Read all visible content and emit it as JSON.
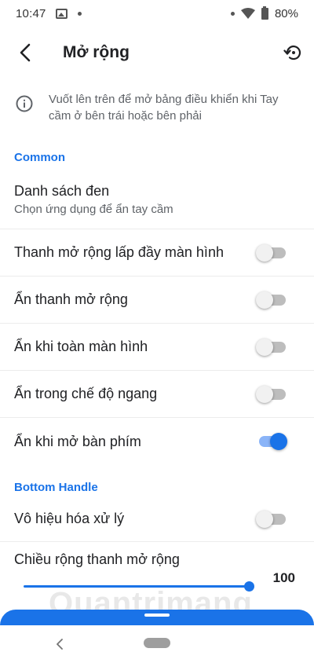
{
  "status_bar": {
    "time": "10:47",
    "battery": "80%"
  },
  "app_bar": {
    "title": "Mở rộng"
  },
  "info": {
    "text": "Vuốt lên trên để mở bảng điều khiển khi Tay cầm ở bên trái hoặc bên phải"
  },
  "sections": {
    "common": {
      "header": "Common",
      "blacklist": {
        "label": "Danh sách đen",
        "sublabel": "Chọn ứng dụng để ẩn tay cầm"
      },
      "fill_screen": {
        "label": "Thanh mở rộng lấp đầy màn hình",
        "on": false
      },
      "hide_handle": {
        "label": "Ẩn thanh mở rộng",
        "on": false
      },
      "hide_fullscreen": {
        "label": "Ẩn khi toàn màn hình",
        "on": false
      },
      "hide_landscape": {
        "label": "Ẩn trong chế độ ngang",
        "on": false
      },
      "hide_keyboard": {
        "label": "Ẩn khi mở bàn phím",
        "on": true
      }
    },
    "bottom_handle": {
      "header": "Bottom Handle",
      "disable": {
        "label": "Vô hiệu hóa xử lý",
        "on": false
      },
      "width": {
        "label": "Chiều rộng thanh mở rộng",
        "value": "100",
        "fraction": 1.0
      }
    }
  },
  "watermark": {
    "text": "Quantrimang"
  },
  "colors": {
    "accent": "#1a73e8",
    "accent_light": "#8ab4f8",
    "text": "#202124",
    "secondary": "#5f6368"
  }
}
